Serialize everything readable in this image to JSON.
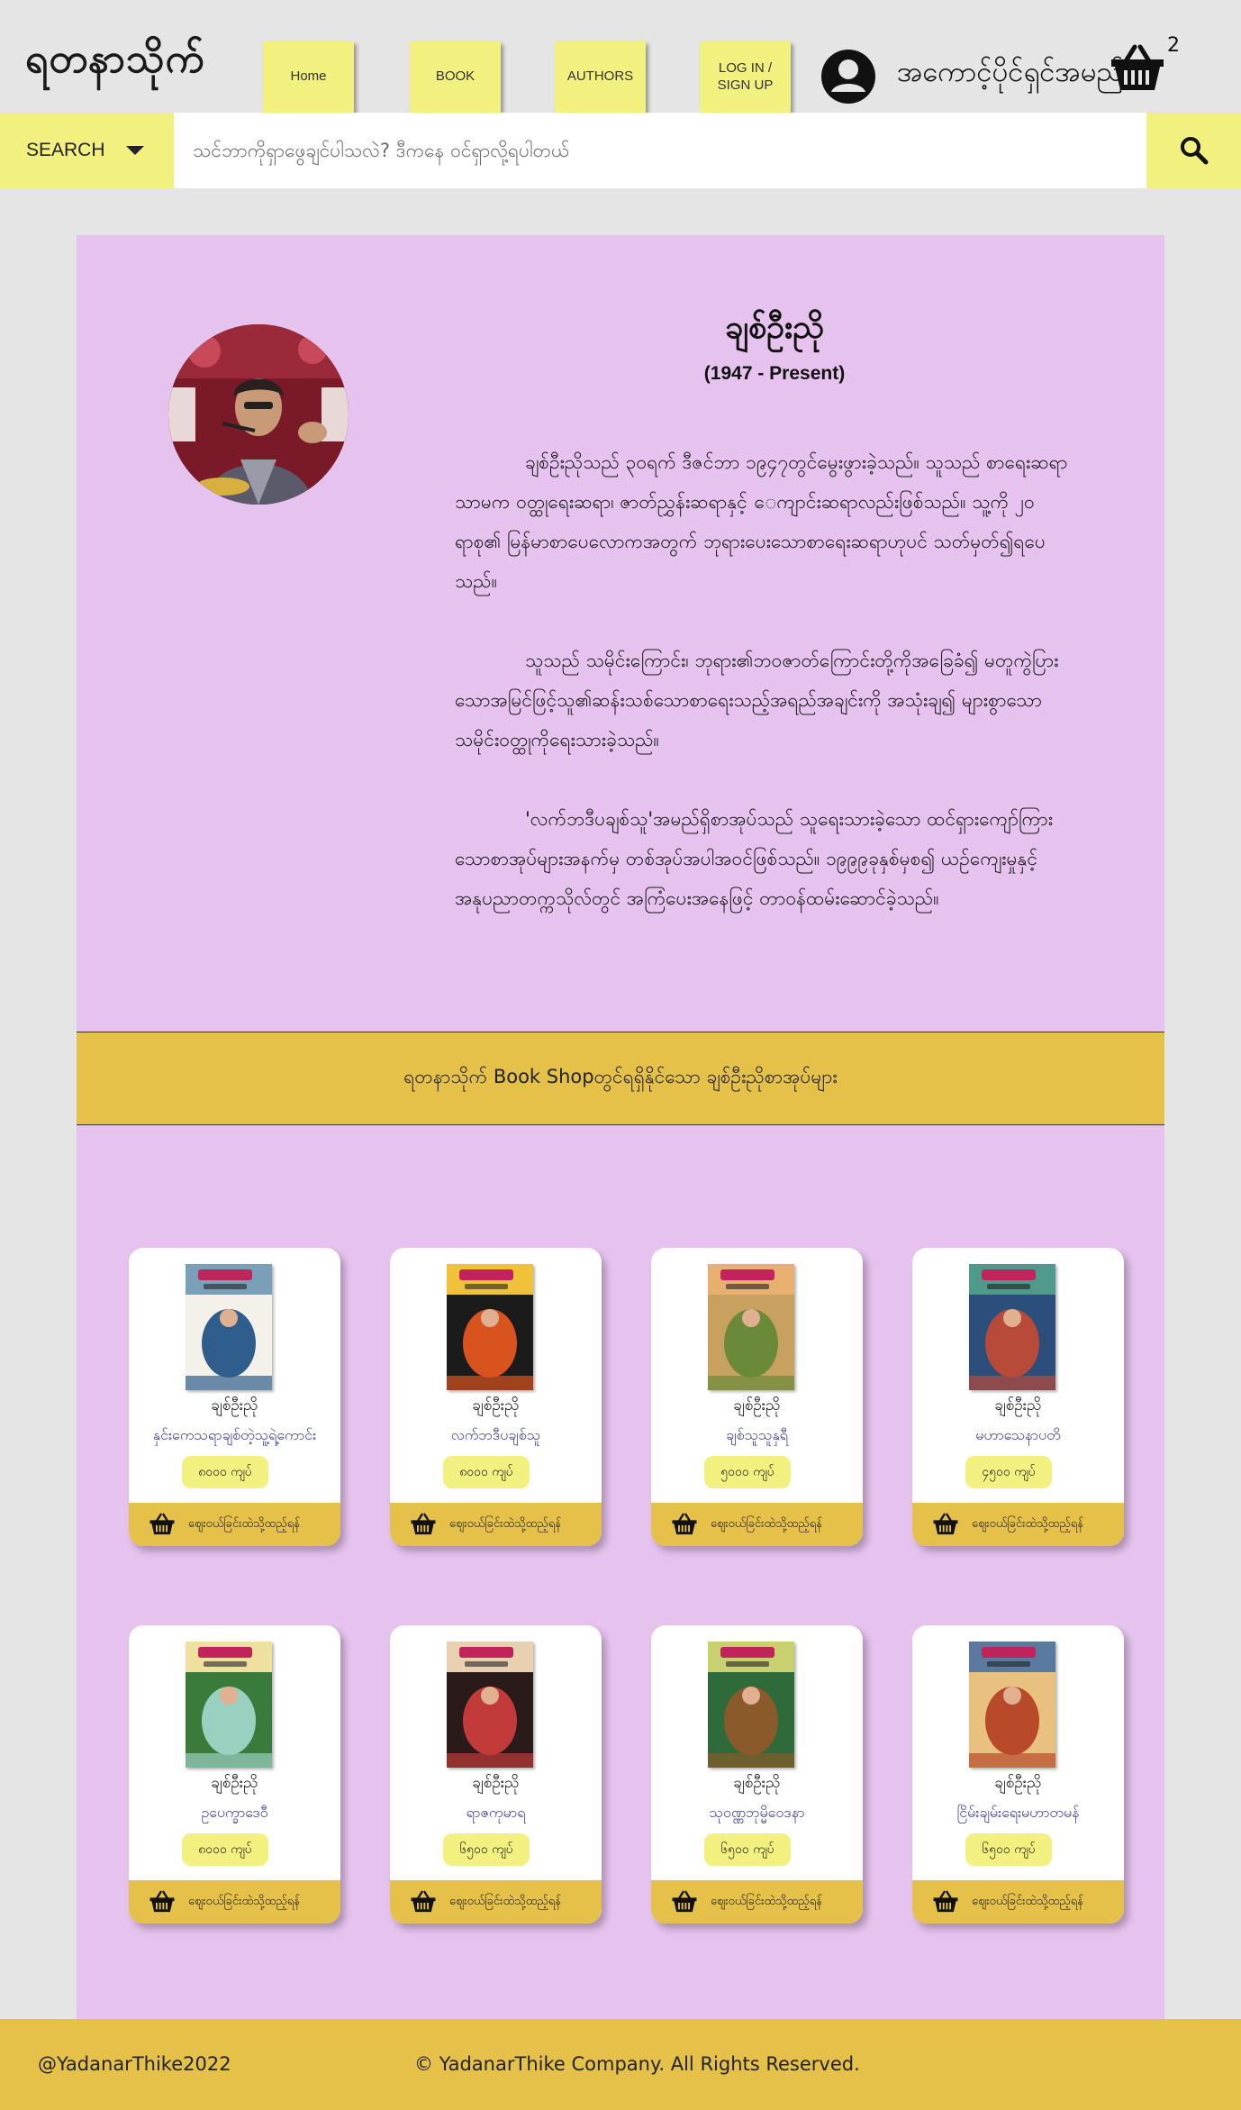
{
  "header": {
    "logo": "ရတနာသိုက်",
    "nav": {
      "home": "Home",
      "book": "BOOK",
      "authors": "AUTHORS",
      "login_line1": "LOG IN /",
      "login_line2": "SIGN UP"
    },
    "user_name": "အကောင့်ပိုင်ရှင်အမည်",
    "user_icon": "user-circle-icon",
    "cart_icon": "basket-icon",
    "cart_count": "2"
  },
  "search": {
    "select_label": "SEARCH",
    "placeholder": "သင်ဘာကိုရှာဖွေချင်ပါသလဲ? ဒီကနေ ဝင်ရှာလို့ရပါတယ်",
    "value": "",
    "button_icon": "search-icon"
  },
  "author": {
    "name": "ချစ်ဦးညို",
    "years": "(1947 - Present)",
    "bio": [
      "ချစ်ဦးညိုသည် ၃၀ရက် ဒီဇင်ဘာ ၁၉၄၇တွင်မွေးဖွားခဲ့သည်။ သူသည် စာရေးဆရာသာမက ဝတ္ထုရေးဆရာ၊ ဇာတ်ညွှန်းဆရာနှင့် ေကျာင်းဆရာလည်းဖြစ်သည်။ သူ့ကို ၂၀ ရာစု၏ မြန်မာစာပေလောကအတွက် ဘုရားပေးသောစာရေးဆရာဟုပင် သတ်မှတ်၍ရပေသည်။",
      "သူသည် သမိုင်းကြောင်း၊ ဘုရား၏ဘဝဇာတ်ကြောင်းတို့ကိုအခြေခံ၍ မတူကွဲပြားသောအမြင်ဖြင့်သူ၏ဆန်းသစ်သောစာရေးသည့်အရည်အချင်းကို အသုံးချ၍ များစွာသော သမိုင်းဝတ္ထုကိုရေးသားခဲ့သည်။",
      "'လက်ဘဒီပချစ်သူ'အမည်ရှိစာအုပ်သည် သူရေးသားခဲ့သော ထင်ရှားကျော်ကြားသောစာအုပ်များအနက်မှ တစ်အုပ်အပါအဝင်ဖြစ်သည်။ ၁၉၉၉ခုနှစ်မှစ၍ ယဉ်ကျေးမှုနှင့်အနုပညာတက္ကသိုလ်တွင် အကြံပေးအနေဖြင့် တာဝန်ထမ်းဆောင်ခဲ့သည်။"
    ]
  },
  "books_heading": "ရတနာသိုက် Book Shopတွင်ရရှိနိုင်သော ချစ်ဦးညိုစာအုပ်များ",
  "buy_label": "ဈေးဝယ်ခြင်းထဲသို့ထည့်ရန်",
  "books": [
    {
      "author": "ချစ်ဦးညို",
      "title": "နှင်းကေသရာချစ်တဲ့သူ့ရဲ့ကောင်း",
      "price": "၈၀၀၀ ကျပ်",
      "cover_colors": [
        "#f4f1ea",
        "#2f5e8c",
        "#7aa0b8"
      ]
    },
    {
      "author": "ချစ်ဦးညို",
      "title": "လက်ဘဒီပချစ်သူ",
      "price": "၈၀၀၀ ကျပ်",
      "cover_colors": [
        "#1b1b1b",
        "#d9531e",
        "#f0c23a"
      ]
    },
    {
      "author": "ချစ်ဦးညို",
      "title": "ချစ်သူသူနှရီ",
      "price": "၅၀၀၀ ကျပ်",
      "cover_colors": [
        "#c8a060",
        "#6a8a3a",
        "#e8b070"
      ]
    },
    {
      "author": "ချစ်ဦးညို",
      "title": "မဟာသေနာပတိ",
      "price": "၄၅၀၀ ကျပ်",
      "cover_colors": [
        "#2b4f7a",
        "#b84a3a",
        "#4f9a8a"
      ]
    },
    {
      "author": "ချစ်ဦးညို",
      "title": "ဥပေက္ခာဒေဝီ",
      "price": "၈၀၀၀ ကျပ်",
      "cover_colors": [
        "#3a7a3a",
        "#9ad0c0",
        "#f0e0a0"
      ]
    },
    {
      "author": "ချစ်ဦးညို",
      "title": "ရာဇကုမာရ",
      "price": "၆၅၀၀ ကျပ်",
      "cover_colors": [
        "#2a1a1a",
        "#c23a3a",
        "#e8d0b0"
      ]
    },
    {
      "author": "ချစ်ဦးညို",
      "title": "သုဝဏ္ဏဘုမ္မိဝေဒနာ",
      "price": "၆၅၀၀ ကျပ်",
      "cover_colors": [
        "#2f6a3a",
        "#8a5a2a",
        "#c8d070"
      ]
    },
    {
      "author": "ချစ်ဦးညို",
      "title": "ငြိမ်းချမ်းရေးမဟာတမန်",
      "price": "၆၅၀၀ ကျပ်",
      "cover_colors": [
        "#e8c080",
        "#b84a2a",
        "#5a7aa0"
      ]
    }
  ],
  "footer": {
    "handle": "@YadanarThike2022",
    "copyright": "© YadanarThike Company. All Rights Reserved."
  },
  "colors": {
    "background": "#e5e5e5",
    "nav_yellow": "#f2f07e",
    "gold": "#e5c14a",
    "panel_purple": "#e6c2ee",
    "link_blue": "#3a3a9c"
  }
}
